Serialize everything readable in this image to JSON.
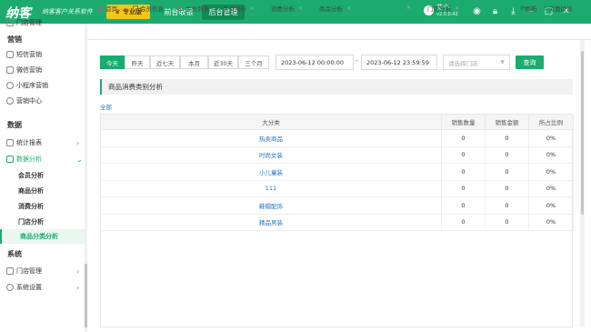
{
  "app": {
    "logo": "纳客",
    "slogan": "纳客客户关系软件",
    "pro_badge": "专业版",
    "top_tabs": [
      "前台收银",
      "后台管理"
    ],
    "user_name": "艾小",
    "user_version": "v2.0.0.42"
  },
  "sidebar": {
    "partial_top": "门店管理",
    "marketing_head": "营销",
    "marketing_items": [
      "短信营销",
      "微信营销",
      "小程序营销",
      "营销中心"
    ],
    "data_head": "数据",
    "stats_report": "统计报表",
    "data_analysis": "数据分析",
    "sub_items": [
      "会员分析",
      "商品分析",
      "消费分析",
      "门店分析",
      "商品分类分析"
    ],
    "system_head": "系统",
    "system_items": [
      "门店管理",
      "系统设置"
    ]
  },
  "tabs": [
    "首页",
    "会员信息",
    "会员列表",
    "会员分析",
    "消费分析",
    "商品分析",
    "商品分类分析",
    "门店分析"
  ],
  "utils": {
    "refresh": "刷新",
    "page_ops": "页面操作"
  },
  "filters": {
    "quick": [
      "今天",
      "昨天",
      "近七天",
      "本月",
      "近30天",
      "三个月"
    ],
    "start": "2023-06-12 00:00:00",
    "dash": "-",
    "end": "2023-06-12 23:59:59",
    "store_placeholder": "请选择门店",
    "search": "查询"
  },
  "section_title": "商品消费类别分析",
  "all_link": "全部",
  "table": {
    "headers": [
      "大分类",
      "销售数量",
      "销售金额",
      "所占比例"
    ],
    "rows": [
      [
        "热卖商品",
        "0",
        "0",
        "0%"
      ],
      [
        "时尚女装",
        "0",
        "0",
        "0%"
      ],
      [
        "小儿童装",
        "0",
        "0",
        "0%"
      ],
      [
        "111",
        "0",
        "0",
        "0%"
      ],
      [
        "鞋帽配饰",
        "0",
        "0",
        "0%"
      ],
      [
        "精品男装",
        "0",
        "0",
        "0%"
      ]
    ]
  },
  "colors": {
    "accent": "#1bab6e",
    "link": "#1c74c4",
    "pro": "#f5c518"
  }
}
